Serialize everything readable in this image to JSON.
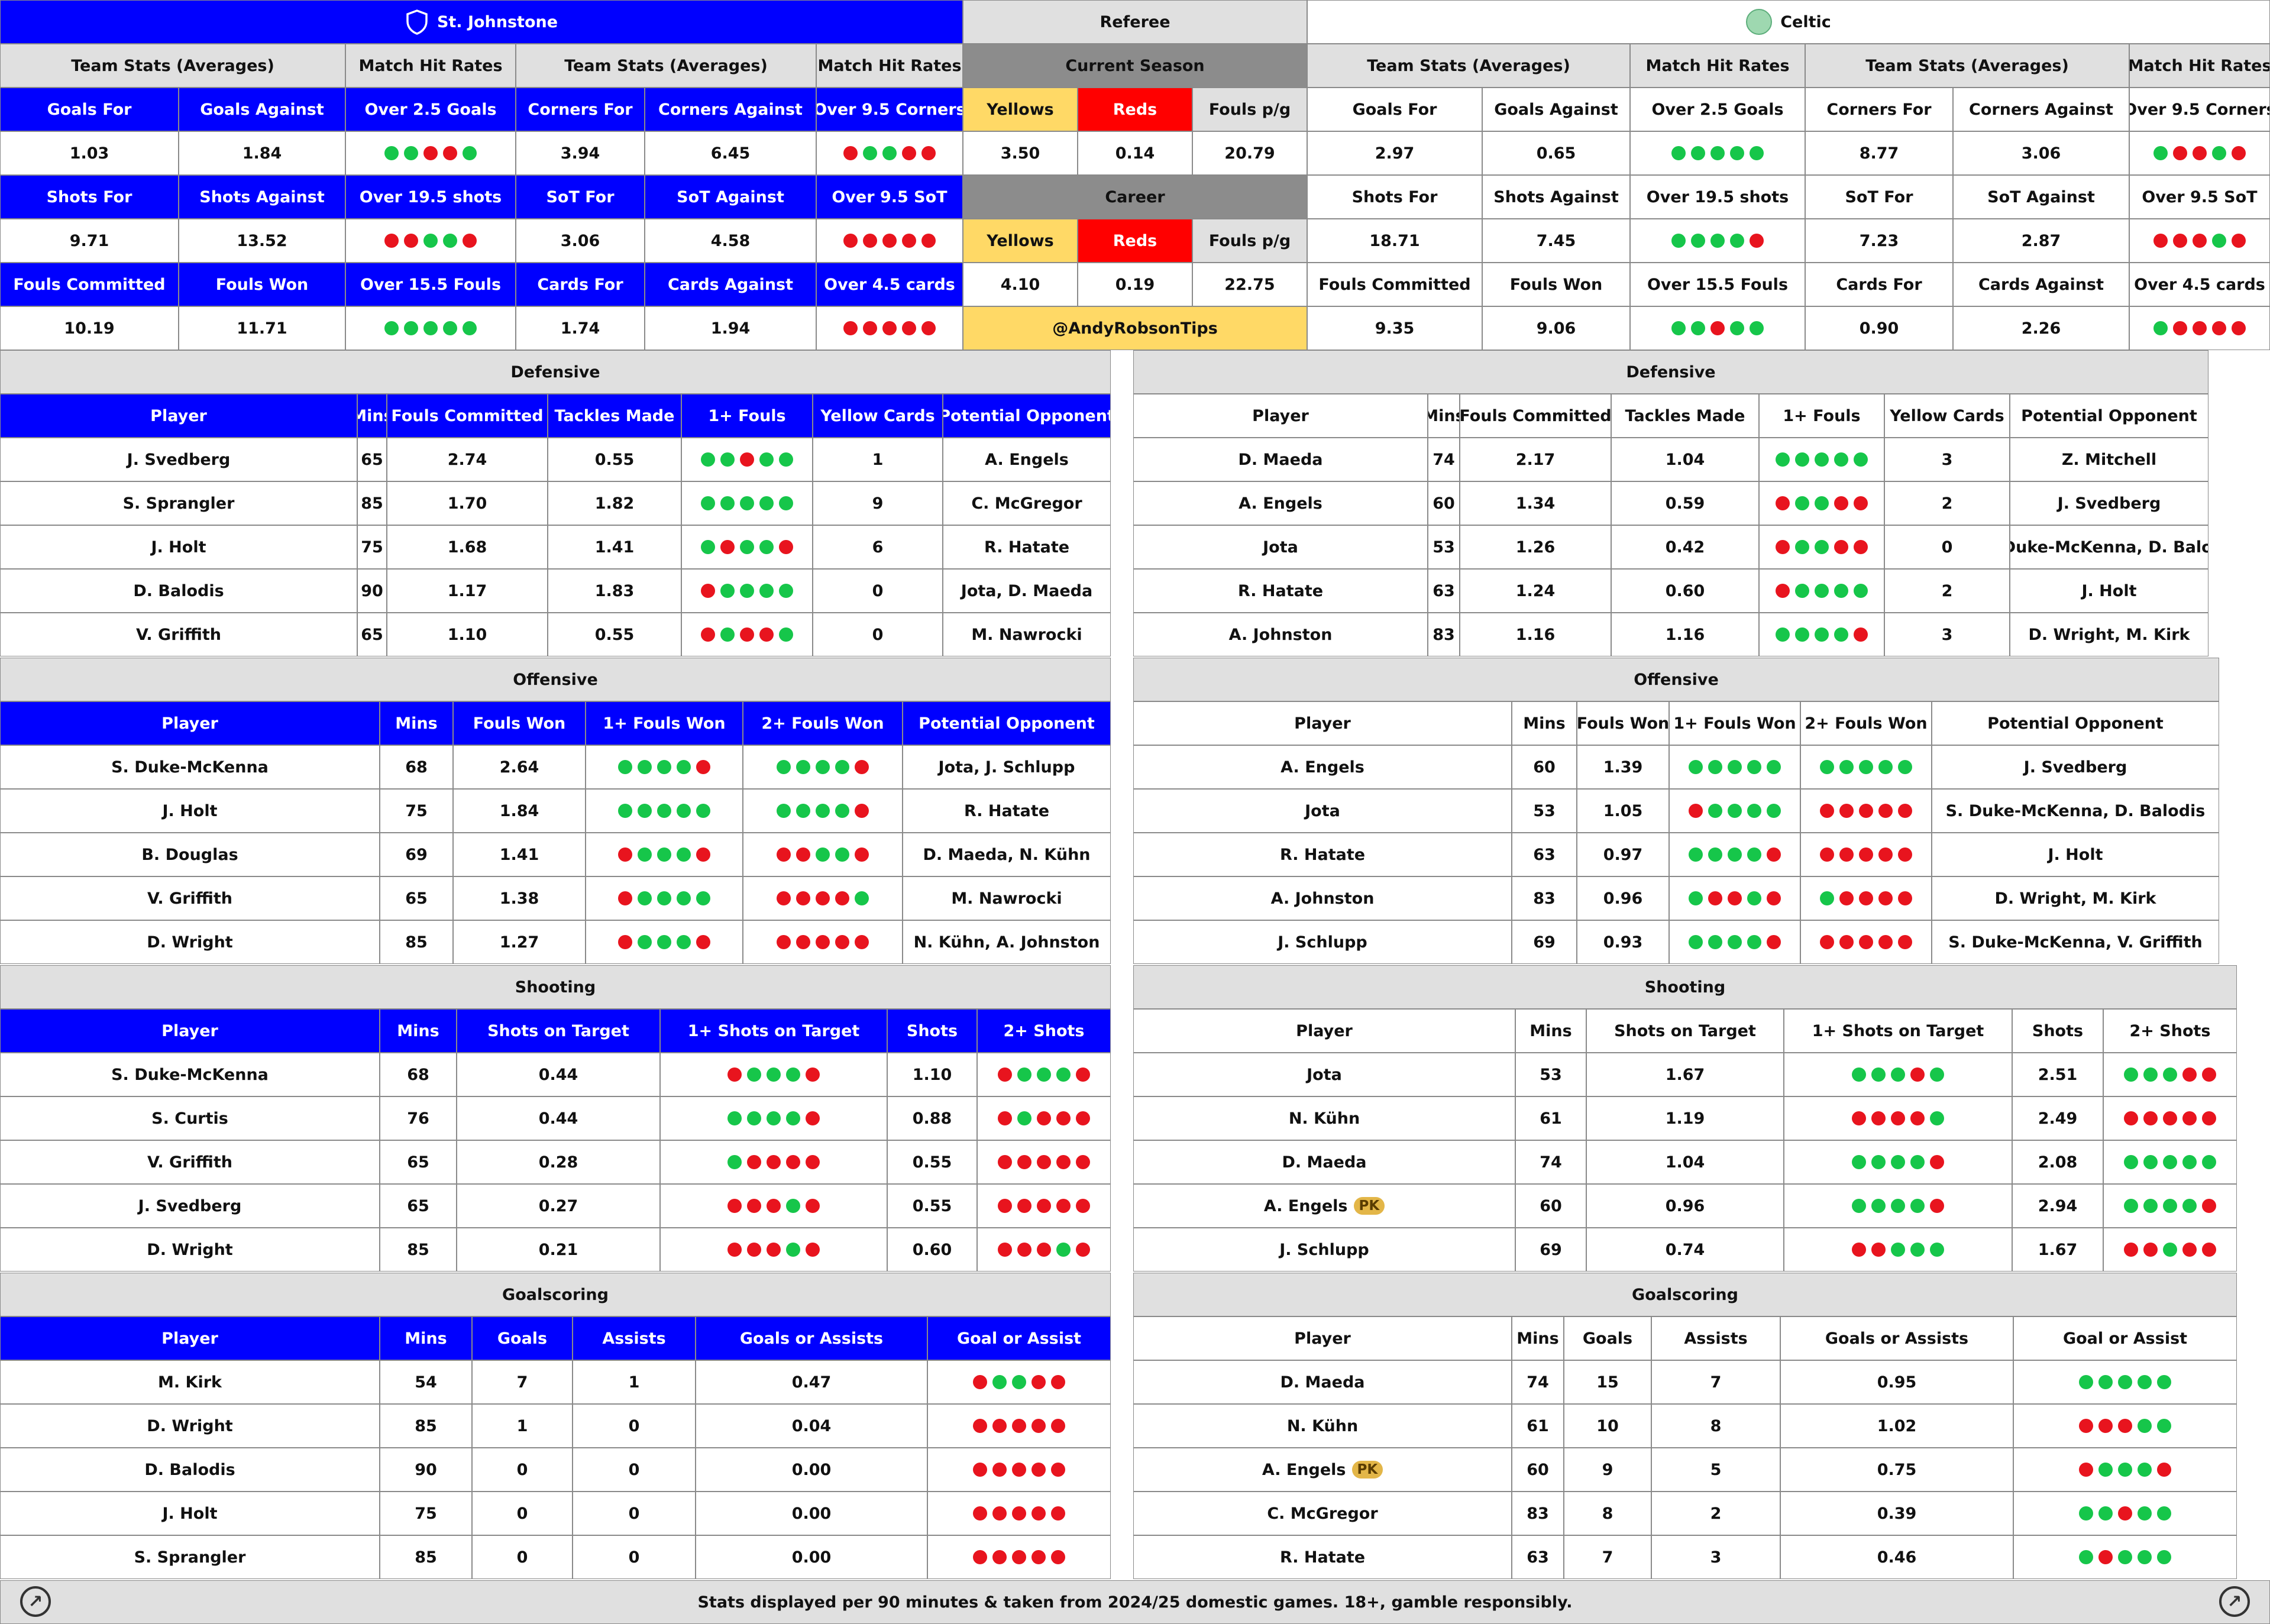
{
  "colors": {
    "home": "#0000ff",
    "green": "#16c64a",
    "red": "#e8141e",
    "yellow": "#ffd966"
  },
  "header": {
    "home_team": "St. Johnstone",
    "referee": "Referee",
    "away_team": "Celtic"
  },
  "labels": {
    "team_stats": "Team Stats (Averages)",
    "match_hit_rates": "Match Hit Rates",
    "current_season": "Current Season",
    "career": "Career",
    "yellows": "Yellows",
    "reds": "Reds",
    "fouls_pg": "Fouls p/g",
    "handle": "@AndyRobsonTips"
  },
  "team_stat_labels": {
    "r1": [
      "Goals For",
      "Goals Against",
      "Over 2.5 Goals",
      "Corners For",
      "Corners Against",
      "Over 9.5 Corners"
    ],
    "r2": [
      "Shots For",
      "Shots Against",
      "Over 19.5 shots",
      "SoT For",
      "SoT Against",
      "Over 9.5 SoT"
    ],
    "r3": [
      "Fouls Committed",
      "Fouls Won",
      "Over 15.5 Fouls",
      "Cards For",
      "Cards Against",
      "Over 4.5 cards"
    ]
  },
  "home_stats": {
    "r1": {
      "a": "1.03",
      "b": "1.84",
      "d1": "ggrrg",
      "c": "3.94",
      "e": "6.45",
      "d2": "rggrr"
    },
    "r2": {
      "a": "9.71",
      "b": "13.52",
      "d1": "rrggr",
      "c": "3.06",
      "e": "4.58",
      "d2": "rrrrr"
    },
    "r3": {
      "a": "10.19",
      "b": "11.71",
      "d1": "ggggg",
      "c": "1.74",
      "e": "1.94",
      "d2": "rrrrr"
    }
  },
  "away_stats": {
    "r1": {
      "a": "2.97",
      "b": "0.65",
      "d1": "ggggg",
      "c": "8.77",
      "e": "3.06",
      "d2": "grrgr"
    },
    "r2": {
      "a": "18.71",
      "b": "7.45",
      "d1": "ggggr",
      "c": "7.23",
      "e": "2.87",
      "d2": "rrrgr"
    },
    "r3": {
      "a": "9.35",
      "b": "9.06",
      "d1": "ggrgg",
      "c": "0.90",
      "e": "2.26",
      "d2": "grrrr"
    }
  },
  "referee": {
    "current": {
      "yellows": "3.50",
      "reds": "0.14",
      "fouls": "20.79"
    },
    "career": {
      "yellows": "4.10",
      "reds": "0.19",
      "fouls": "22.75"
    }
  },
  "sections": {
    "defensive": "Defensive",
    "offensive": "Offensive",
    "shooting": "Shooting",
    "goalscoring": "Goalscoring"
  },
  "def_cols": [
    "Player",
    "Mins",
    "Fouls Committed",
    "Tackles Made",
    "1+ Fouls",
    "Yellow Cards",
    "Potential Opponent"
  ],
  "off_cols": [
    "Player",
    "Mins",
    "Fouls Won",
    "1+ Fouls Won",
    "2+ Fouls Won",
    "Potential Opponent"
  ],
  "sho_cols": [
    "Player",
    "Mins",
    "Shots on Target",
    "1+ Shots on Target",
    "Shots",
    "2+ Shots"
  ],
  "goa_cols": [
    "Player",
    "Mins",
    "Goals",
    "Assists",
    "Goals or Assists",
    "Goal or Assist"
  ],
  "home_def": [
    [
      "J. Svedberg",
      "65",
      "2.74",
      "0.55",
      "ggrgg",
      "1",
      "A. Engels"
    ],
    [
      "S. Sprangler",
      "85",
      "1.70",
      "1.82",
      "ggggg",
      "9",
      "C. McGregor"
    ],
    [
      "J. Holt",
      "75",
      "1.68",
      "1.41",
      "grggr",
      "6",
      "R. Hatate"
    ],
    [
      "D. Balodis",
      "90",
      "1.17",
      "1.83",
      "rgggg",
      "0",
      "Jota, D. Maeda"
    ],
    [
      "V. Griffith",
      "65",
      "1.10",
      "0.55",
      "rgrrg",
      "0",
      "M. Nawrocki"
    ]
  ],
  "away_def": [
    [
      "D. Maeda",
      "74",
      "2.17",
      "1.04",
      "ggggg",
      "3",
      "Z. Mitchell"
    ],
    [
      "A. Engels",
      "60",
      "1.34",
      "0.59",
      "rggrr",
      "2",
      "J. Svedberg"
    ],
    [
      "Jota",
      "53",
      "1.26",
      "0.42",
      "rggrr",
      "0",
      "S. Duke-McKenna, D. Balodis"
    ],
    [
      "R. Hatate",
      "63",
      "1.24",
      "0.60",
      "rgggg",
      "2",
      "J. Holt"
    ],
    [
      "A. Johnston",
      "83",
      "1.16",
      "1.16",
      "ggggr",
      "3",
      "D. Wright, M. Kirk"
    ]
  ],
  "home_off": [
    [
      "S. Duke-McKenna",
      "68",
      "2.64",
      "ggggr",
      "ggggr",
      "Jota, J. Schlupp"
    ],
    [
      "J. Holt",
      "75",
      "1.84",
      "ggggg",
      "ggggr",
      "R. Hatate"
    ],
    [
      "B. Douglas",
      "69",
      "1.41",
      "rgggr",
      "rrggr",
      "D. Maeda, N. Kühn"
    ],
    [
      "V. Griffith",
      "65",
      "1.38",
      "rgggg",
      "rrrrg",
      "M. Nawrocki"
    ],
    [
      "D. Wright",
      "85",
      "1.27",
      "rgggr",
      "rrrrr",
      "N. Kühn, A. Johnston"
    ]
  ],
  "away_off": [
    [
      "A. Engels",
      "60",
      "1.39",
      "ggggg",
      "ggggg",
      "J. Svedberg"
    ],
    [
      "Jota",
      "53",
      "1.05",
      "rgggg",
      "rrrrr",
      "S. Duke-McKenna, D. Balodis"
    ],
    [
      "R. Hatate",
      "63",
      "0.97",
      "ggggr",
      "rrrrr",
      "J. Holt"
    ],
    [
      "A. Johnston",
      "83",
      "0.96",
      "grrgr",
      "grrrr",
      "D. Wright, M. Kirk"
    ],
    [
      "J. Schlupp",
      "69",
      "0.93",
      "ggggr",
      "rrrrr",
      "S. Duke-McKenna, V. Griffith"
    ]
  ],
  "home_sho": [
    [
      "S. Duke-McKenna",
      "68",
      "0.44",
      "rgggr",
      "1.10",
      "rgggr"
    ],
    [
      "S. Curtis",
      "76",
      "0.44",
      "ggggr",
      "0.88",
      "rgrrr"
    ],
    [
      "V. Griffith",
      "65",
      "0.28",
      "grrrr",
      "0.55",
      "rrrrr"
    ],
    [
      "J. Svedberg",
      "65",
      "0.27",
      "rrrgr",
      "0.55",
      "rrrrr"
    ],
    [
      "D. Wright",
      "85",
      "0.21",
      "rrrgr",
      "0.60",
      "rrrgr"
    ]
  ],
  "away_sho": [
    [
      "Jota",
      "53",
      "1.67",
      "gggrg",
      "2.51",
      "gggrr"
    ],
    [
      "N. Kühn",
      "61",
      "1.19",
      "rrrrg",
      "2.49",
      "rrrrr"
    ],
    [
      "D. Maeda",
      "74",
      "1.04",
      "ggggr",
      "2.08",
      "ggggg"
    ],
    [
      "A. Engels",
      "60",
      "0.96",
      "ggggr",
      "2.94",
      "ggggr"
    ],
    [
      "J. Schlupp",
      "69",
      "0.74",
      "rrggg",
      "1.67",
      "rrgrr"
    ]
  ],
  "home_goa": [
    [
      "M. Kirk",
      "54",
      "7",
      "1",
      "0.47",
      "rggrr"
    ],
    [
      "D. Wright",
      "85",
      "1",
      "0",
      "0.04",
      "rrrrr"
    ],
    [
      "D. Balodis",
      "90",
      "0",
      "0",
      "0.00",
      "rrrrr"
    ],
    [
      "J. Holt",
      "75",
      "0",
      "0",
      "0.00",
      "rrrrr"
    ],
    [
      "S. Sprangler",
      "85",
      "0",
      "0",
      "0.00",
      "rrrrr"
    ]
  ],
  "away_goa": [
    [
      "D. Maeda",
      "74",
      "15",
      "7",
      "0.95",
      "ggggg"
    ],
    [
      "N. Kühn",
      "61",
      "10",
      "8",
      "1.02",
      "rrrgg"
    ],
    [
      "A. Engels",
      "60",
      "9",
      "5",
      "0.75",
      "rgggr"
    ],
    [
      "C. McGregor",
      "83",
      "8",
      "2",
      "0.39",
      "ggrgg"
    ],
    [
      "R. Hatate",
      "63",
      "7",
      "3",
      "0.46",
      "grggg"
    ]
  ],
  "pk_badge": "PK",
  "pk_players": {
    "away_sho": 3,
    "away_goa": 2
  },
  "footer": "Stats displayed per 90 minutes & taken from 2024/25 domestic games. 18+, gamble responsibly.",
  "icons": [
    "shield-icon",
    "football-icon",
    "bookmaker-logo-icon"
  ]
}
